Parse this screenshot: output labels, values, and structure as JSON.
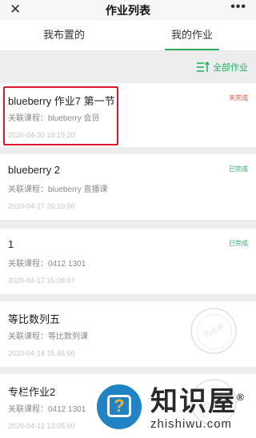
{
  "topbar": {
    "title": "作业列表",
    "close_icon": "close-icon",
    "more_icon": "more-dots-icon"
  },
  "tabs": [
    {
      "label": "我布置的",
      "active": false
    },
    {
      "label": "我的作业",
      "active": true
    }
  ],
  "toolbar": {
    "all_label": "全部作业",
    "icon": "filter-sort-icon"
  },
  "course_prefix": "关联课程：",
  "assignments": [
    {
      "name": "blueberry 作业7 第一节",
      "course": "blueberry 会员",
      "time": "2020-04-30 19:19:20",
      "status": "未完成",
      "state": "pending"
    },
    {
      "name": "blueberry 2",
      "course": "blueberry 直播课",
      "time": "2020-04-27 20:10:50",
      "status": "已完成",
      "state": "done"
    },
    {
      "name": "1",
      "course": "0412 1301",
      "time": "2020-04-17 15:09:07",
      "status": "已完成",
      "state": "done"
    },
    {
      "name": "等比数列五",
      "course": "等比数列课",
      "time": "2020-04-14 15:46:56",
      "status": "",
      "state": "reviewed"
    },
    {
      "name": "专栏作业2",
      "course": "0412 1301",
      "time": "2020-04-12 13:05:00",
      "status": "",
      "state": "reviewed"
    }
  ],
  "stamp_text": "已点评",
  "watermark": {
    "cn": "知识屋",
    "en": "zhishiwu.com",
    "reg": "®"
  },
  "colors": {
    "accent": "#2aae67",
    "pending": "#e2553b",
    "highlight": "#e0162b"
  }
}
